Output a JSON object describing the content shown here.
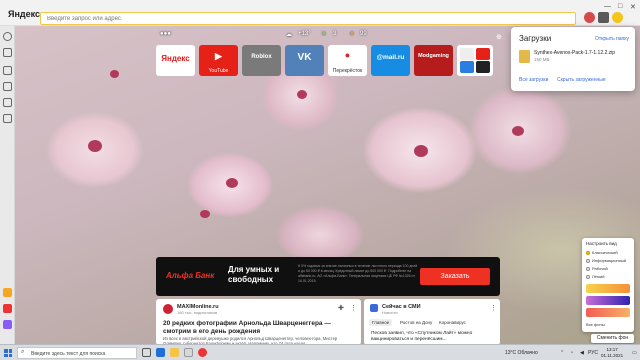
{
  "browser": {
    "brand": "Яндекс",
    "address_placeholder": "Введите запрос или адрес",
    "accent": "#f0c84a"
  },
  "weather_strip": {
    "temperature": "+13°",
    "score_one": "3",
    "score_two": "99"
  },
  "tiles": [
    {
      "name": "Яндекс",
      "sub": "",
      "bg": "#ffffff",
      "fg": "#e21b1b"
    },
    {
      "name": "▶",
      "sub": "YouTube",
      "bg": "#e62117",
      "fg": "#ffffff"
    },
    {
      "name": "Roblox",
      "sub": "",
      "bg": "#7a7a7a",
      "fg": "#ffffff"
    },
    {
      "name": "VK",
      "sub": "",
      "bg": "#5181b8",
      "fg": "#ffffff"
    },
    {
      "name": "●",
      "sub": "Перекрёсток",
      "bg": "#ffffff",
      "fg": "#d6262c"
    },
    {
      "name": "@mail.ru",
      "sub": "",
      "bg": "#168de2",
      "fg": "#ffffff"
    },
    {
      "name": "Modgaming",
      "sub": "",
      "bg": "#b71c1c",
      "fg": "#ffffff"
    }
  ],
  "downloads": {
    "title": "Загрузки",
    "open_folder": "Открыть папку",
    "file_name": "Synthex-Avenox-Pack-1.7-1.12.2.zip",
    "file_size": "150 МБ",
    "all_downloads": "Все загрузки",
    "hide_downloaded": "Скрыть загруженные"
  },
  "ad": {
    "bank": "Альфа Банк",
    "headline": "Для умных и свободных",
    "fine_print": "К 0% годовых за снятие наличных в течение льготного периода 100 дней и до 50 000 ₽ в месяц. Кредитный лимит до 500 000 ₽. Подробнее на alfabank.ru. АО «Альфа-Банк». Генеральная лицензия ЦБ РФ №1326 от 16.01.2015.",
    "button": "Заказать"
  },
  "feed": {
    "card1": {
      "source": "MAXIMonline.ru",
      "source_sub": "180 тыс. подписчиков",
      "headline": "20 редких фотографии Арнольда Шварценеггера — смотрим в его день рождения",
      "body": "Из всех в австрийской деревушке родился Арнольд Шварценеггер, человек-гора, Мистер Олимпия, губернатор Калифорнии и актёр. Напомним, что 74 года назад..."
    },
    "card2": {
      "title": "Сейчас в СМИ",
      "subtitle": "Новости",
      "tabs": [
        "Главное",
        "Ростов на Дону",
        "Коронавирус"
      ],
      "item": "Песков заявил, что «Спутником Лайт» можно вакцинироваться и перенёсшим..."
    }
  },
  "theme": {
    "title": "Настроить вид",
    "options": [
      "Классический",
      "Информационный",
      "Рабочий",
      "Лёгкий"
    ],
    "selected_index": 0,
    "caption": "Все фоны",
    "change_bg": "Сменить фон"
  },
  "taskbar": {
    "search_placeholder": "Введите здесь текст для поиска",
    "weather": "13°C Облачно",
    "lang": "РУС",
    "time": "13:17",
    "date": "01.11.2021"
  }
}
